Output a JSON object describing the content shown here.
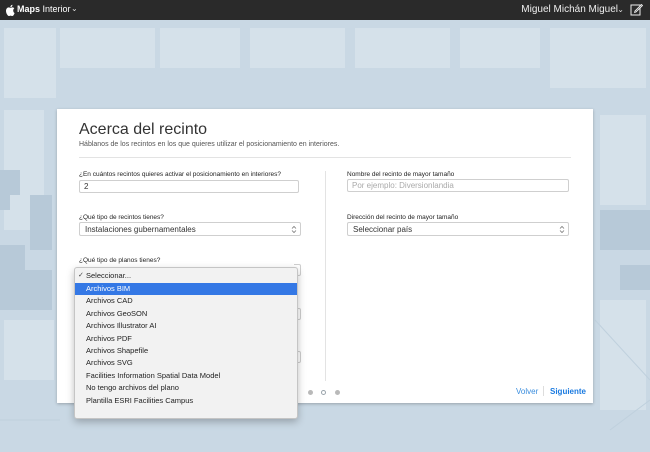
{
  "topbar": {
    "brand_bold": "Maps",
    "brand_rest": "Interior",
    "brand_chevron": "⌄",
    "user_name": "Miguel Michán Miguel",
    "user_chevron": "⌄"
  },
  "form": {
    "title": "Acerca del recinto",
    "subtitle": "Háblanos de los recintos en los que quieres utilizar el posicionamiento en interiores.",
    "q_count_label": "¿En cuántos recintos quieres activar el posicionamiento en interiores?",
    "q_count_value": "2",
    "q_type_label": "¿Qué tipo de recintos tienes?",
    "q_type_value": "Instalaciones gubernamentales",
    "q_plans_label": "¿Qué tipo de planos tienes?",
    "q_name_label": "Nombre del recinto de mayor tamaño",
    "q_name_placeholder": "Por ejemplo: Diversionlandia",
    "q_address_label": "Dirección del recinto de mayor tamaño",
    "q_address_value": "Seleccionar país"
  },
  "footer": {
    "back_label": "Volver",
    "next_label": "Siguiente"
  },
  "dropdown": {
    "check": "✓",
    "placeholder": "Seleccionar...",
    "options": [
      "Archivos BIM",
      "Archivos CAD",
      "Archivos GeoSON",
      "Archivos Illustrator AI",
      "Archivos PDF",
      "Archivos Shapefile",
      "Archivos SVG",
      "Facilities Information Spatial Data Model",
      "No tengo archivos del plano",
      "Plantilla ESRI Facilities Campus"
    ],
    "highlighted_index": 0
  },
  "colors": {
    "accent": "#1a7ae0",
    "highlight": "#3478e5",
    "map": "#c9d8e4",
    "topbar": "#2a2a2a"
  }
}
